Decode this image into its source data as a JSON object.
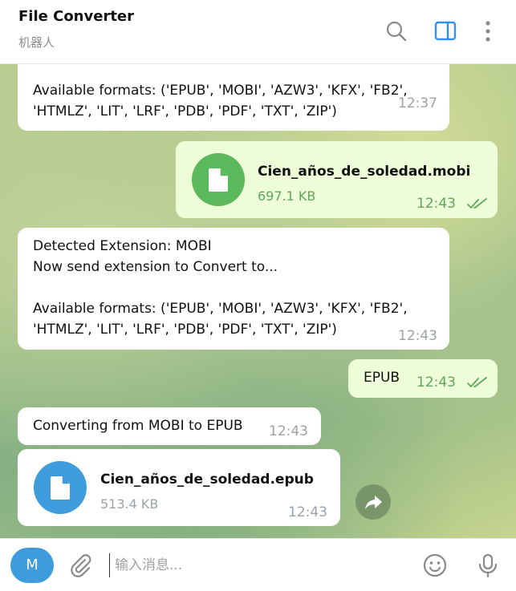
{
  "header": {
    "title": "File Converter",
    "subtitle": "机器人",
    "icons": [
      "search-icon",
      "sidebar-toggle-icon",
      "more-vertical-icon"
    ]
  },
  "messages": [
    {
      "type": "text",
      "direction": "in",
      "text": "Available formats: ('EPUB', 'MOBI', 'AZW3', 'KFX', 'FB2',\n'HTMLZ', 'LIT', 'LRF', 'PDB', 'PDF', 'TXT', 'ZIP')",
      "time": "12:37"
    },
    {
      "type": "file",
      "direction": "out",
      "filename": "Cien_años_de_soledad.mobi",
      "size": "697.1 KB",
      "time": "12:43",
      "status": "read"
    },
    {
      "type": "text",
      "direction": "in",
      "text": "Detected Extension: MOBI\nNow send extension to Convert to...\n\nAvailable formats: ('EPUB', 'MOBI', 'AZW3', 'KFX', 'FB2',\n'HTMLZ', 'LIT', 'LRF', 'PDB', 'PDF', 'TXT', 'ZIP')",
      "time": "12:43"
    },
    {
      "type": "text",
      "direction": "out",
      "text": "EPUB",
      "time": "12:43",
      "status": "read"
    },
    {
      "type": "text",
      "direction": "in",
      "text": "Converting from MOBI to EPUB",
      "time": "12:43"
    },
    {
      "type": "file",
      "direction": "in",
      "filename": "Cien_años_de_soledad.epub",
      "size": "513.4 KB",
      "time": "12:43"
    }
  ],
  "composer": {
    "avatar_initial": "M",
    "placeholder": "输入消息..."
  },
  "colors": {
    "incoming_bubble": "#ffffff",
    "outgoing_bubble": "#eefed9",
    "outgoing_accent": "#5ea55e",
    "file_icon_out": "#5cb85c",
    "file_icon_in": "#3e9cdc",
    "avatar": "#3e9cdc"
  }
}
